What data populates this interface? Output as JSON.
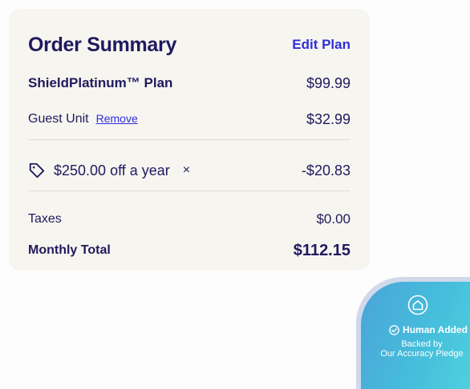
{
  "order_summary": {
    "title": "Order Summary",
    "edit_plan_label": "Edit Plan",
    "plan": {
      "name": "ShieldPlatinum™ Plan",
      "price": "$99.99"
    },
    "guest_unit": {
      "label": "Guest Unit",
      "remove_label": "Remove",
      "price": "$32.99"
    },
    "promo": {
      "icon": "tag-icon",
      "text": "$250.00 off a year",
      "remove_symbol": "×",
      "amount": "-$20.83"
    },
    "taxes": {
      "label": "Taxes",
      "value": "$0.00"
    },
    "total": {
      "label": "Monthly Total",
      "value": "$112.15"
    }
  },
  "badge": {
    "icon": "home-shield-icon",
    "check_icon": "check-circle-icon",
    "title": "Human Added",
    "subtitle_line1": "Backed by",
    "subtitle_line2": "Our Accuracy Pledge"
  },
  "colors": {
    "heading": "#1f1a5e",
    "link": "#2f2fd8",
    "card_background": "#f7f5f0",
    "badge_gradient_start": "#4aa4d8",
    "badge_gradient_end": "#55d6e0"
  }
}
